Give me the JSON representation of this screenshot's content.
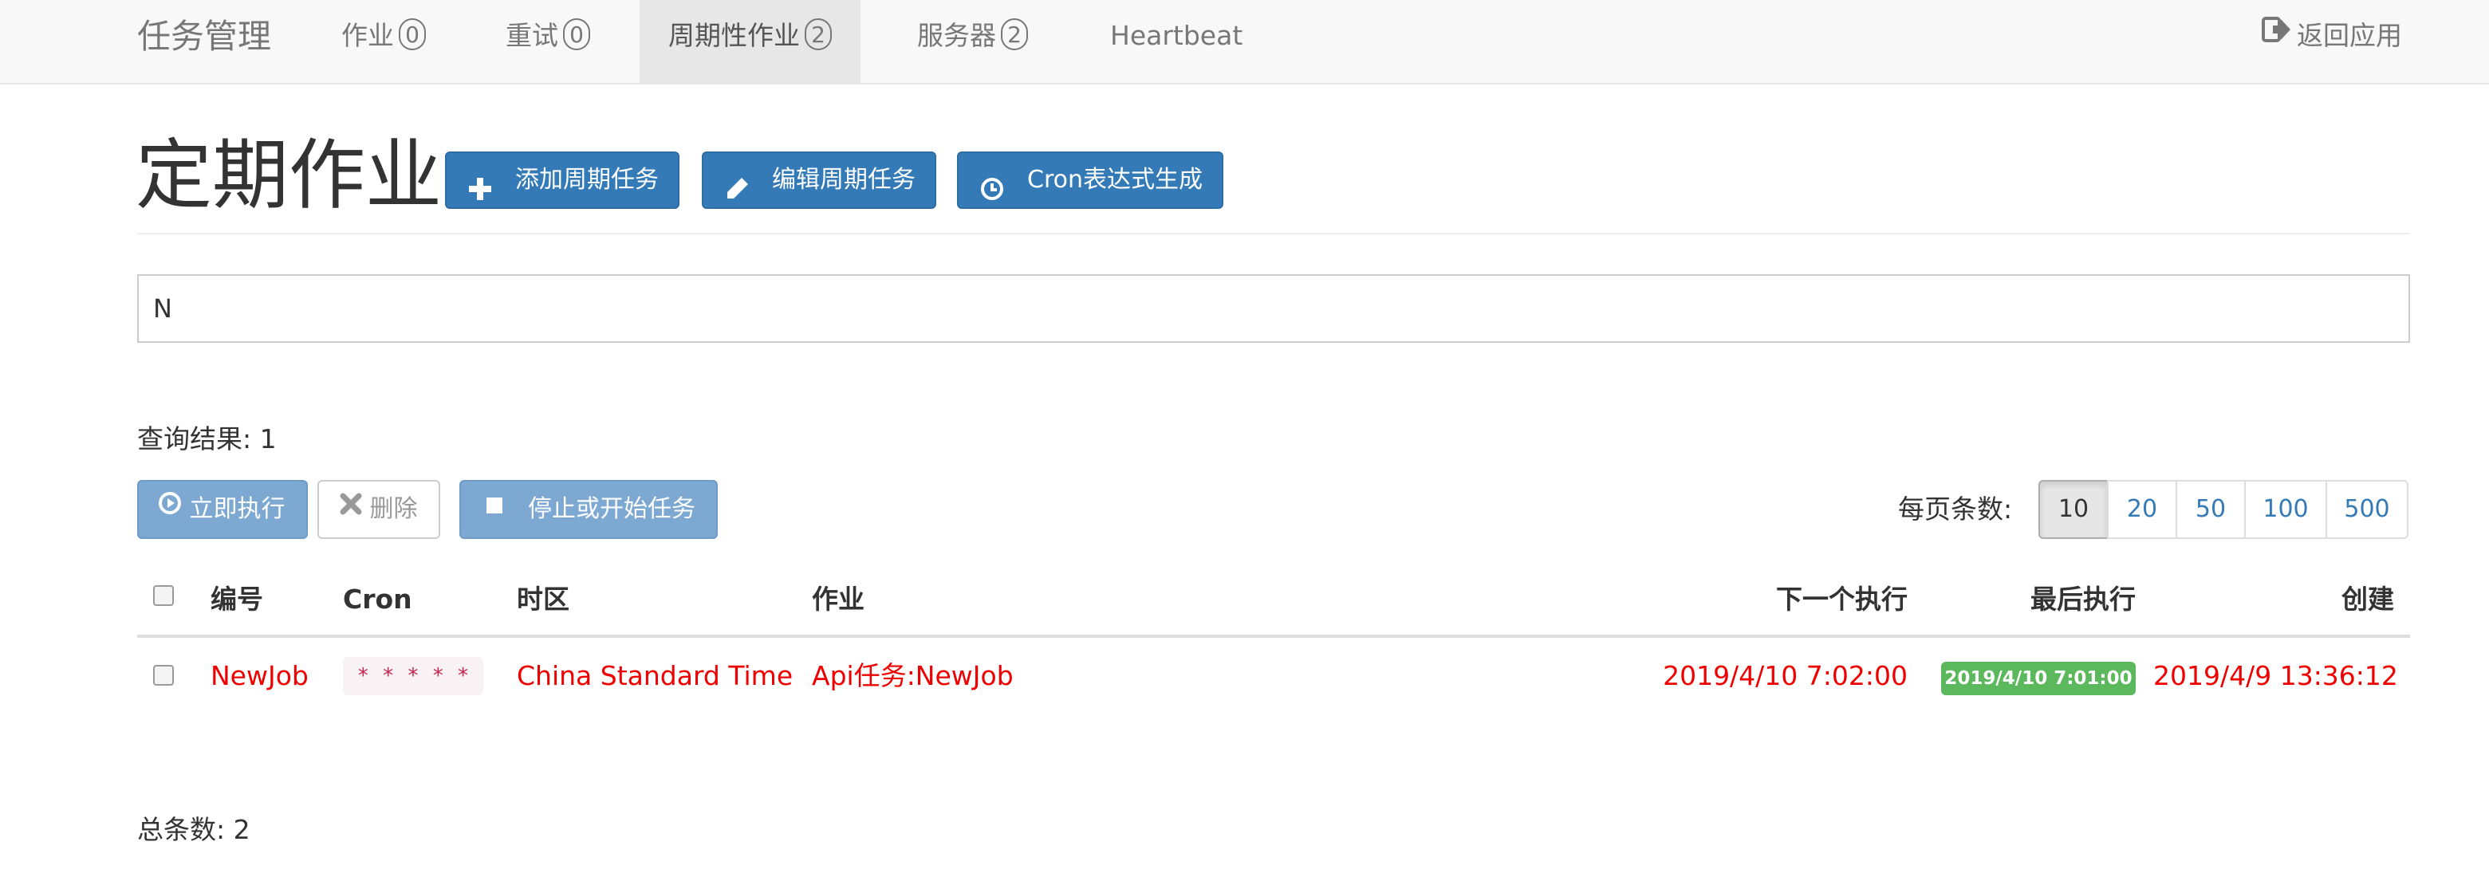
{
  "nav": {
    "brand": "任务管理",
    "items": [
      {
        "label": "作业",
        "badge": "0",
        "active": false
      },
      {
        "label": "重试",
        "badge": "0",
        "active": false
      },
      {
        "label": "周期性作业",
        "badge": "2",
        "active": true
      },
      {
        "label": "服务器",
        "badge": "2",
        "active": false
      },
      {
        "label": "Heartbeat",
        "badge": "",
        "active": false
      }
    ],
    "back_label": "返回应用"
  },
  "header": {
    "title": "定期作业",
    "buttons": [
      {
        "label": "添加周期任务",
        "icon": "plus-icon"
      },
      {
        "label": "编辑周期任务",
        "icon": "pencil-icon"
      },
      {
        "label": "Cron表达式生成",
        "icon": "clock-icon"
      }
    ]
  },
  "filter": {
    "value": "N",
    "placeholder": ""
  },
  "result_count_text": "查询结果: 1",
  "actions": {
    "trigger_label": "立即执行",
    "delete_label": "删除",
    "toggle_label": "停止或开始任务"
  },
  "pagination": {
    "per_page_label": "每页条数:",
    "options": [
      "10",
      "20",
      "50",
      "100",
      "500"
    ],
    "selected": "10"
  },
  "table": {
    "columns": [
      "编号",
      "Cron",
      "时区",
      "作业",
      "下一个执行",
      "最后执行",
      "创建"
    ],
    "rows": [
      {
        "id": "NewJob",
        "cron": "* * * * *",
        "timezone": "China Standard Time",
        "job": "Api任务:NewJob",
        "next_execution": "2019/4/10 7:02:00",
        "last_execution": "2019/4/10 7:01:00",
        "created": "2019/4/9 13:36:12"
      }
    ]
  },
  "total_text": "总条数: 2",
  "colors": {
    "primary": "#337ab7",
    "primary_disabled": "#7ca8d2",
    "row_text": "#ee0000",
    "success": "#5cb85c",
    "code_text": "#c7254e",
    "navbar_bg": "#f8f8f8"
  }
}
